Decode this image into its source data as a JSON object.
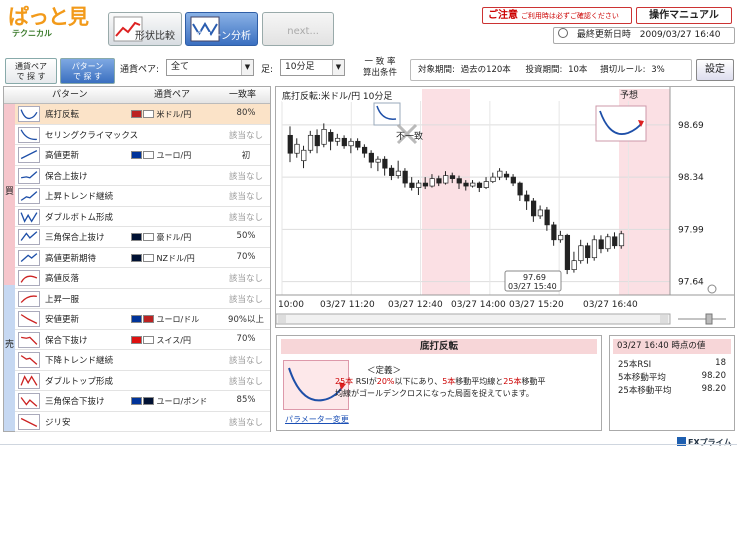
{
  "header": {
    "logo_main": "ぱっと見",
    "logo_sub": "テクニカル",
    "tabs": [
      {
        "label": "形状比較"
      },
      {
        "label": "パターン分析"
      },
      {
        "label": "next..."
      }
    ],
    "notice_bold": "ご注意",
    "notice_small": "ご利用時は必ずご確認ください",
    "manual_label": "操作マニュアル",
    "updated_label": "最終更新日時",
    "updated_value": "2009/03/27 16:40"
  },
  "toolbar": {
    "search_pair_l1": "通貨ペア",
    "search_pair_l2": "で 探 す",
    "search_pattern_l1": "パターン",
    "search_pattern_l2": "で 探 す",
    "pair_label": "通貨ペア:",
    "pair_value": "全て",
    "foot_label": "足:",
    "foot_value": "10分足",
    "match_l1": "一 致 率",
    "match_l2": "算出条件",
    "period_label": "対象期間:",
    "period_value": "過去の120本",
    "vote_label": "投資期間:",
    "vote_value": "10本",
    "cut_label": "損切ルール:",
    "cut_value": "3%",
    "settings_label": "設定"
  },
  "panel": {
    "col_pattern": "パターン",
    "col_pair": "通貨ペア",
    "col_rate": "一致率",
    "buy_label": "買",
    "sell_label": "売",
    "rows": [
      {
        "name": "底打反転",
        "pair": "米ドル/円",
        "rate": "80%"
      },
      {
        "name": "セリングクライマックス",
        "pair": "",
        "rate": "該当なし"
      },
      {
        "name": "高値更新",
        "pair": "ユーロ/円",
        "rate": "初"
      },
      {
        "name": "保合上抜け",
        "pair": "",
        "rate": "該当なし"
      },
      {
        "name": "上昇トレンド継続",
        "pair": "",
        "rate": "該当なし"
      },
      {
        "name": "ダブルボトム形成",
        "pair": "",
        "rate": "該当なし"
      },
      {
        "name": "三角保合上抜け",
        "pair": "豪ドル/円",
        "rate": "50%"
      },
      {
        "name": "高値更新期待",
        "pair": "NZドル/円",
        "rate": "70%"
      },
      {
        "name": "高値反落",
        "pair": "",
        "rate": "該当なし"
      },
      {
        "name": "上昇一服",
        "pair": "",
        "rate": "該当なし"
      },
      {
        "name": "安値更新",
        "pair": "ユーロ/ドル",
        "rate": "90%以上"
      },
      {
        "name": "保合下抜け",
        "pair": "スイス/円",
        "rate": "70%"
      },
      {
        "name": "下降トレンド継続",
        "pair": "",
        "rate": "該当なし"
      },
      {
        "name": "ダブルトップ形成",
        "pair": "",
        "rate": "該当なし"
      },
      {
        "name": "三角保合下抜け",
        "pair": "ユーロ/ポンド",
        "rate": "85%"
      },
      {
        "name": "ジリ安",
        "pair": "",
        "rate": "該当なし"
      }
    ]
  },
  "chart": {
    "title": "底打反転:米ドル/円 10分足",
    "mismatch_label": "不一致",
    "forecast_label": "予想",
    "low_price": "97.69",
    "low_time": "03/27 15:40",
    "y_ticks": [
      "98.69",
      "98.34",
      "97.99",
      "97.64"
    ],
    "x_ticks": [
      "10:00",
      "03/27 11:20",
      "03/27 12:40",
      "03/27 14:00",
      "03/27 15:20",
      "03/27 16:40"
    ]
  },
  "chart_data": {
    "type": "candlestick",
    "title": "底打反転:米ドル/円 10分足",
    "x_labels": [
      "10:00",
      "03/27 11:20",
      "03/27 12:40",
      "03/27 14:00",
      "03/27 15:20",
      "03/27 16:40"
    ],
    "y_ticks": [
      98.69,
      98.34,
      97.99,
      97.64
    ],
    "ylim": [
      97.55,
      98.85
    ],
    "candles": [
      [
        98.62,
        98.5,
        98.68,
        98.44
      ],
      [
        98.5,
        98.56,
        98.6,
        98.47
      ],
      [
        98.45,
        98.52,
        98.55,
        98.4
      ],
      [
        98.52,
        98.62,
        98.65,
        98.5
      ],
      [
        98.62,
        98.55,
        98.66,
        98.5
      ],
      [
        98.56,
        98.66,
        98.7,
        98.54
      ],
      [
        98.64,
        98.58,
        98.66,
        98.52
      ],
      [
        98.58,
        98.6,
        98.63,
        98.55
      ],
      [
        98.6,
        98.55,
        98.62,
        98.53
      ],
      [
        98.55,
        98.58,
        98.6,
        98.5
      ],
      [
        98.58,
        98.54,
        98.6,
        98.52
      ],
      [
        98.54,
        98.5,
        98.56,
        98.47
      ],
      [
        98.5,
        98.44,
        98.52,
        98.4
      ],
      [
        98.44,
        98.46,
        98.48,
        98.38
      ],
      [
        98.46,
        98.4,
        98.48,
        98.35
      ],
      [
        98.4,
        98.35,
        98.42,
        98.32
      ],
      [
        98.35,
        98.38,
        98.45,
        98.33
      ],
      [
        98.38,
        98.3,
        98.4,
        98.27
      ],
      [
        98.3,
        98.27,
        98.34,
        98.25
      ],
      [
        98.27,
        98.3,
        98.32,
        98.22
      ],
      [
        98.3,
        98.28,
        98.34,
        98.26
      ],
      [
        98.28,
        98.33,
        98.36,
        98.27
      ],
      [
        98.33,
        98.3,
        98.35,
        98.28
      ],
      [
        98.3,
        98.35,
        98.38,
        98.29
      ],
      [
        98.35,
        98.33,
        98.37,
        98.3
      ],
      [
        98.33,
        98.3,
        98.35,
        98.26
      ],
      [
        98.3,
        98.28,
        98.32,
        98.25
      ],
      [
        98.28,
        98.3,
        98.32,
        98.27
      ],
      [
        98.3,
        98.27,
        98.31,
        98.24
      ],
      [
        98.27,
        98.31,
        98.34,
        98.26
      ],
      [
        98.31,
        98.34,
        98.37,
        98.3
      ],
      [
        98.34,
        98.38,
        98.4,
        98.32
      ],
      [
        98.36,
        98.34,
        98.38,
        98.32
      ],
      [
        98.34,
        98.3,
        98.36,
        98.28
      ],
      [
        98.3,
        98.22,
        98.31,
        98.18
      ],
      [
        98.22,
        98.18,
        98.25,
        98.12
      ],
      [
        98.18,
        98.08,
        98.2,
        98.04
      ],
      [
        98.08,
        98.12,
        98.15,
        98.06
      ],
      [
        98.12,
        98.02,
        98.14,
        97.98
      ],
      [
        98.02,
        97.92,
        98.04,
        97.88
      ],
      [
        97.92,
        97.95,
        97.98,
        97.9
      ],
      [
        97.95,
        97.72,
        97.96,
        97.69
      ],
      [
        97.72,
        97.78,
        97.84,
        97.7
      ],
      [
        97.78,
        97.88,
        97.92,
        97.76
      ],
      [
        97.88,
        97.8,
        97.9,
        97.76
      ],
      [
        97.8,
        97.92,
        97.95,
        97.78
      ],
      [
        97.92,
        97.86,
        97.95,
        97.83
      ],
      [
        97.86,
        97.94,
        97.96,
        97.84
      ],
      [
        97.94,
        97.88,
        97.97,
        97.86
      ],
      [
        97.88,
        97.96,
        97.98,
        97.86
      ]
    ]
  },
  "detail": {
    "title": "底打反転",
    "def_heading": "＜定義＞",
    "def_p1": "25本",
    "def_p2": " RSIが",
    "def_p3": "20%",
    "def_p4": "以下にあり、",
    "def_p5": "5本",
    "def_p6": "移動平均線と",
    "def_p7": "25本",
    "def_p8": "移動平",
    "def_line2": "均線がゴールデンクロスになった局面を捉えています。",
    "param_link": "パラメーター変更"
  },
  "values": {
    "title": "03/27 16:40 時点の値",
    "rows": [
      {
        "label": "25本RSI",
        "value": "18"
      },
      {
        "label": "5本移動平均",
        "value": "98.20"
      },
      {
        "label": "25本移動平均",
        "value": "98.20"
      }
    ]
  },
  "footer": {
    "brand": "FXプライム"
  },
  "colors": {
    "buy": "#f6c6cc",
    "sell": "#c6d8f2",
    "selected": "#fbe3c8",
    "accent": "#3a6fc0",
    "red": "#cc0000"
  }
}
